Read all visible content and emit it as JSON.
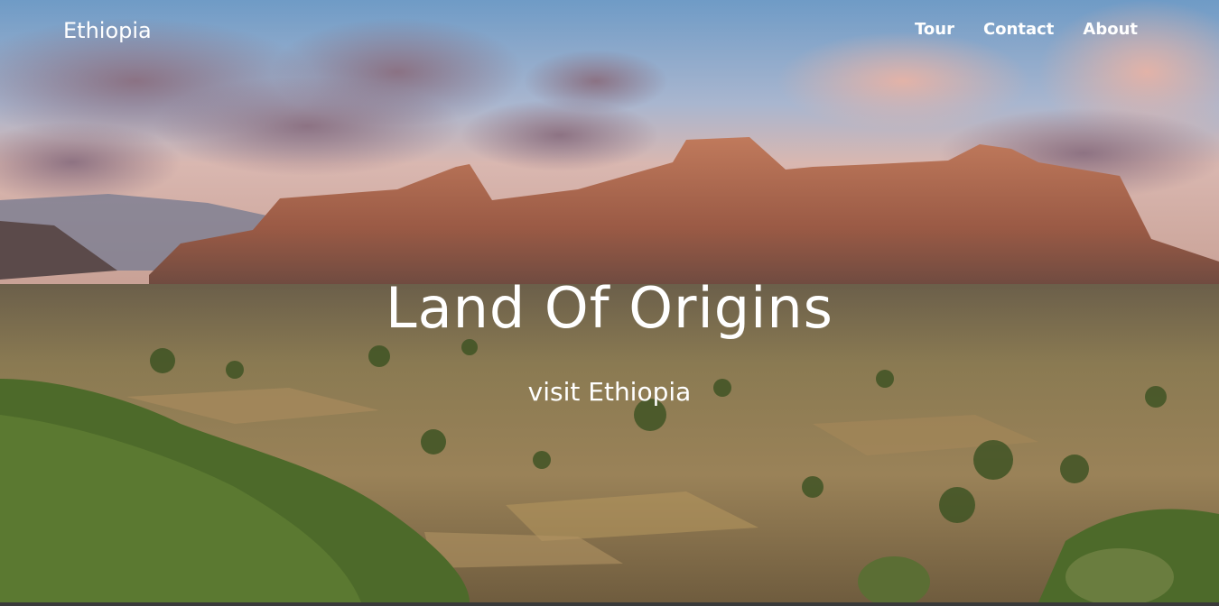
{
  "nav": {
    "brand": "Ethiopia",
    "links": [
      {
        "label": "Tour"
      },
      {
        "label": "Contact"
      },
      {
        "label": "About"
      }
    ]
  },
  "hero": {
    "title": "Land Of Origins",
    "subtitle": "visit Ethiopia"
  },
  "colors": {
    "text": "#ffffff",
    "sky_top": "#6f9bc6",
    "rock": "#a8624a",
    "plain": "#8a7a52",
    "vegetation": "#4d6a2a"
  }
}
